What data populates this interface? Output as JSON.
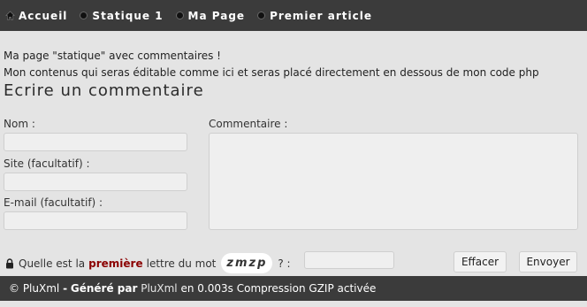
{
  "nav": {
    "items": [
      {
        "label": "Accueil",
        "icon": "home-icon"
      },
      {
        "label": "Statique 1",
        "icon": "bullet-icon"
      },
      {
        "label": "Ma Page",
        "icon": "bullet-icon"
      },
      {
        "label": "Premier article",
        "icon": "bullet-icon"
      }
    ]
  },
  "intro": {
    "line1": "Ma page \"statique\" avec commentaires !",
    "line2": "Mon contenus qui seras éditable comme ici et seras placé directement en dessous de mon code php"
  },
  "form": {
    "title": "Ecrire un commentaire",
    "name_label": "Nom :",
    "site_label": "Site (facultatif) :",
    "email_label": "E-mail (facultatif) :",
    "comment_label": "Commentaire :"
  },
  "captcha": {
    "prefix": "Quelle est la",
    "emph": "première",
    "suffix": "lettre du mot",
    "word": "zmzp",
    "after": "? :"
  },
  "buttons": {
    "reset": "Effacer",
    "submit": "Envoyer"
  },
  "footer": {
    "copyright": "© PluXml",
    "dash": "-",
    "generated": "Généré par",
    "powered": "PluXml",
    "timing": "en 0.003s",
    "gzip": "Compression GZIP activée"
  },
  "colors": {
    "bar": "#3b3b3b",
    "background": "#e4e4e4",
    "emphasis": "#8b0000"
  }
}
